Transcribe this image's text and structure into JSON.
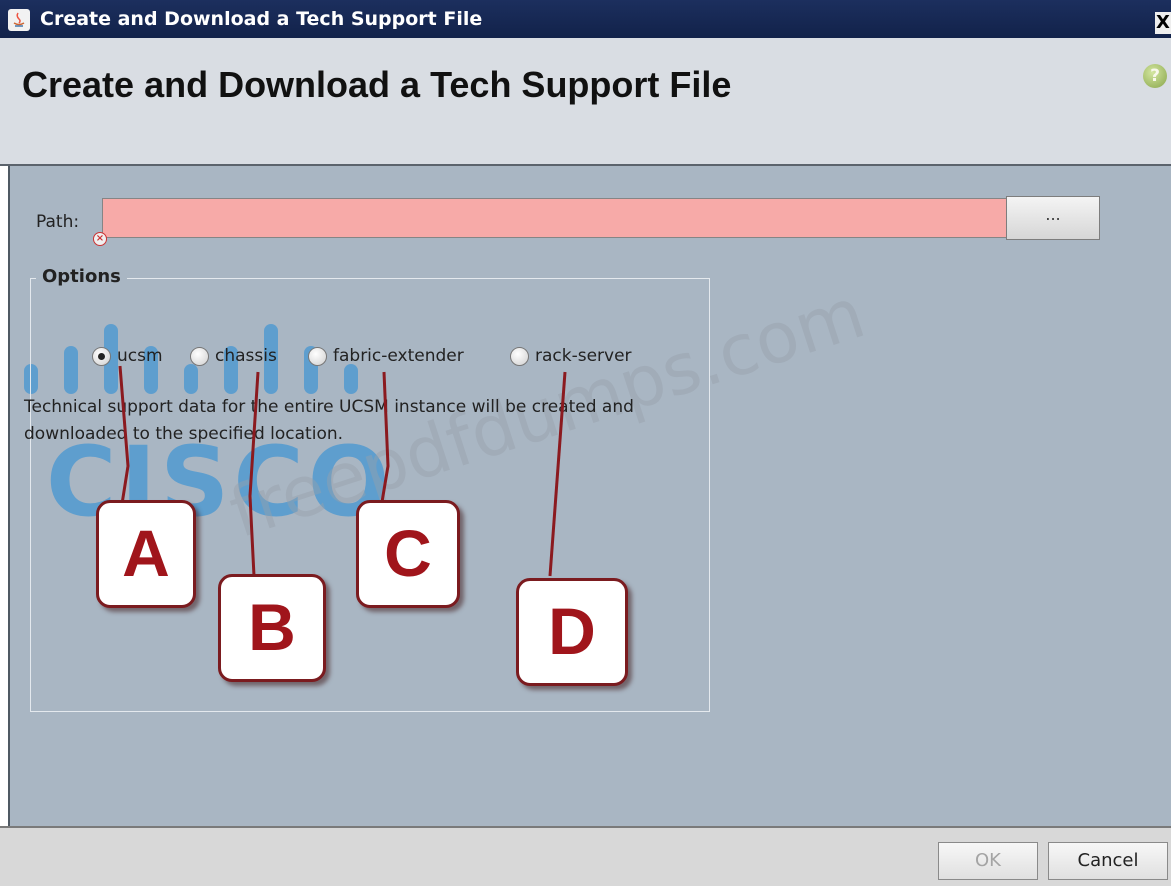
{
  "window": {
    "title": "Create and Download a Tech Support File",
    "close_label": "X"
  },
  "header": {
    "title": "Create and Download a Tech Support File",
    "help_label": "?"
  },
  "form": {
    "path_label": "Path:",
    "path_value": "",
    "browse_label": "...",
    "options_label": "Options",
    "radios": [
      {
        "label": "ucsm",
        "checked": true
      },
      {
        "label": "chassis",
        "checked": false
      },
      {
        "label": "fabric-extender",
        "checked": false
      },
      {
        "label": "rack-server",
        "checked": false
      }
    ],
    "description": "Technical support data for the entire UCSM instance will be created and downloaded to the specified location."
  },
  "callouts": [
    "A",
    "B",
    "C",
    "D"
  ],
  "watermarks": {
    "logo": "CISCO",
    "url": "freepdfdumps.com"
  },
  "footer": {
    "ok_label": "OK",
    "cancel_label": "Cancel"
  },
  "colors": {
    "titlebar": "#12224a",
    "main_bg": "#a9b6c3",
    "error_field": "#f7aaa8",
    "callout_red": "#a0151b"
  }
}
